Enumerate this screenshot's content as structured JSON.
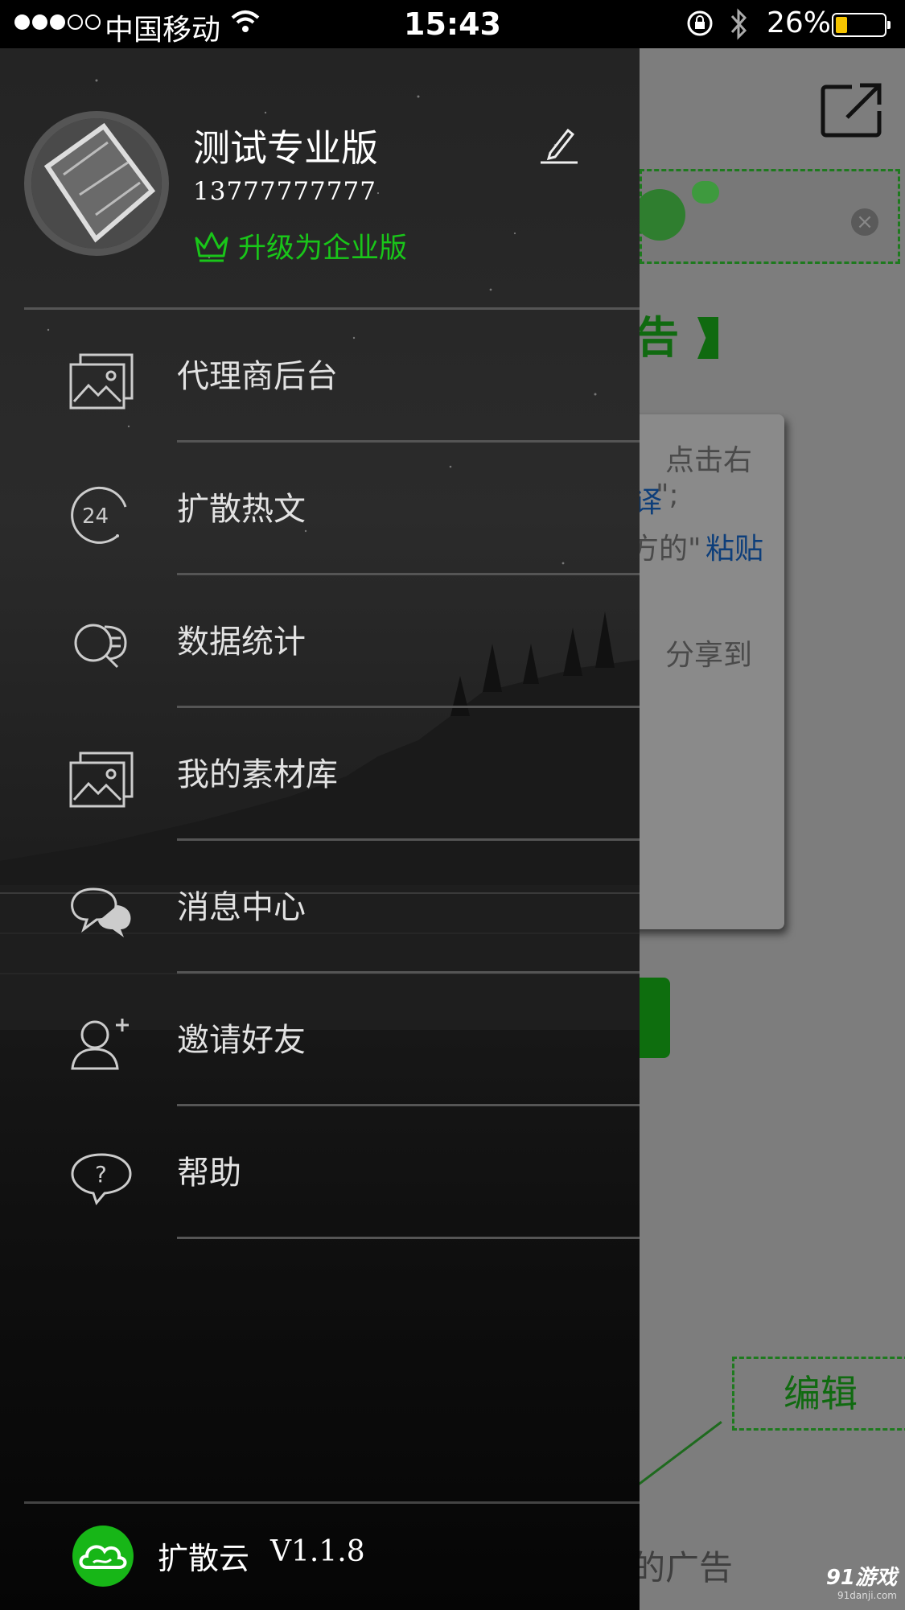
{
  "status_bar": {
    "carrier": "中国移动",
    "time": "15:43",
    "battery_percent": "26%",
    "battery_level": 0.26,
    "signal_bars_filled": 3,
    "signal_bars_total": 5
  },
  "drawer": {
    "profile": {
      "name": "测试专业版",
      "phone": "13777777777",
      "upgrade_label": "升级为企业版"
    },
    "menu": [
      {
        "label": "代理商后台",
        "icon": "picture-icon"
      },
      {
        "label": "扩散热文",
        "icon": "24-hour-icon"
      },
      {
        "label": "数据统计",
        "icon": "search-list-icon"
      },
      {
        "label": "我的素材库",
        "icon": "picture-icon"
      },
      {
        "label": "消息中心",
        "icon": "chat-bubbles-icon"
      },
      {
        "label": "邀请好友",
        "icon": "add-user-icon"
      },
      {
        "label": "帮助",
        "icon": "help-bubble-icon"
      }
    ],
    "footer": {
      "app_name": "扩散云",
      "version": "V1.1.8"
    }
  },
  "background_page": {
    "title_fragment": "告",
    "card_lines": [
      "点击右",
      "\";",
      "方的\"",
      "粘贴",
      "分享到"
    ],
    "card_quote_mark": "译",
    "edit_button": "编辑",
    "bottom_text": "的广告"
  },
  "watermark": {
    "brand": "91游戏",
    "domain": "91danji.com"
  },
  "colors": {
    "accent_green": "#19c619",
    "drawer_text": "#e2e2e2",
    "link_blue": "#0d3e7a"
  }
}
